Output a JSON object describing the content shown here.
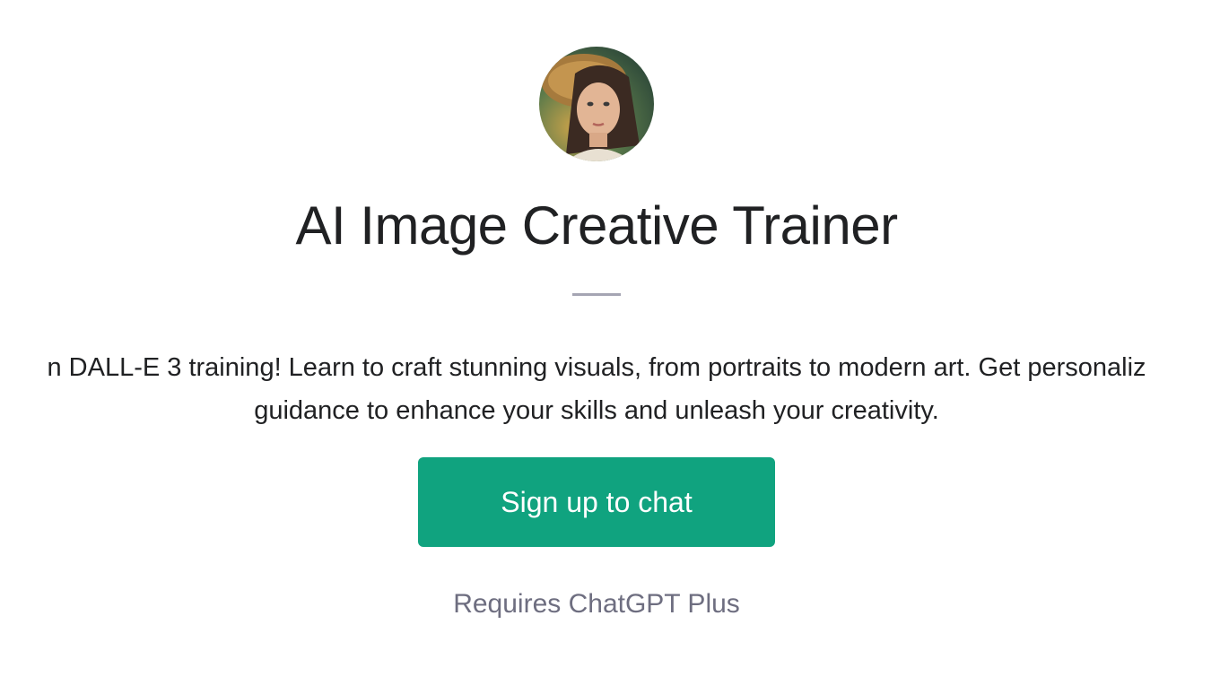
{
  "gpt": {
    "avatar_icon": "portrait-avatar-icon",
    "title": "AI Image Creative Trainer",
    "description_lines": [
      "n DALL-E 3 training! Learn to craft stunning visuals, from portraits to modern art. Get personaliz",
      "guidance to enhance your skills and unleash your creativity."
    ]
  },
  "actions": {
    "signup_label": "Sign up to chat",
    "requirement": "Requires ChatGPT Plus"
  },
  "colors": {
    "accent": "#10a37f",
    "title_text": "#202123",
    "muted_text": "#6e6e80"
  }
}
